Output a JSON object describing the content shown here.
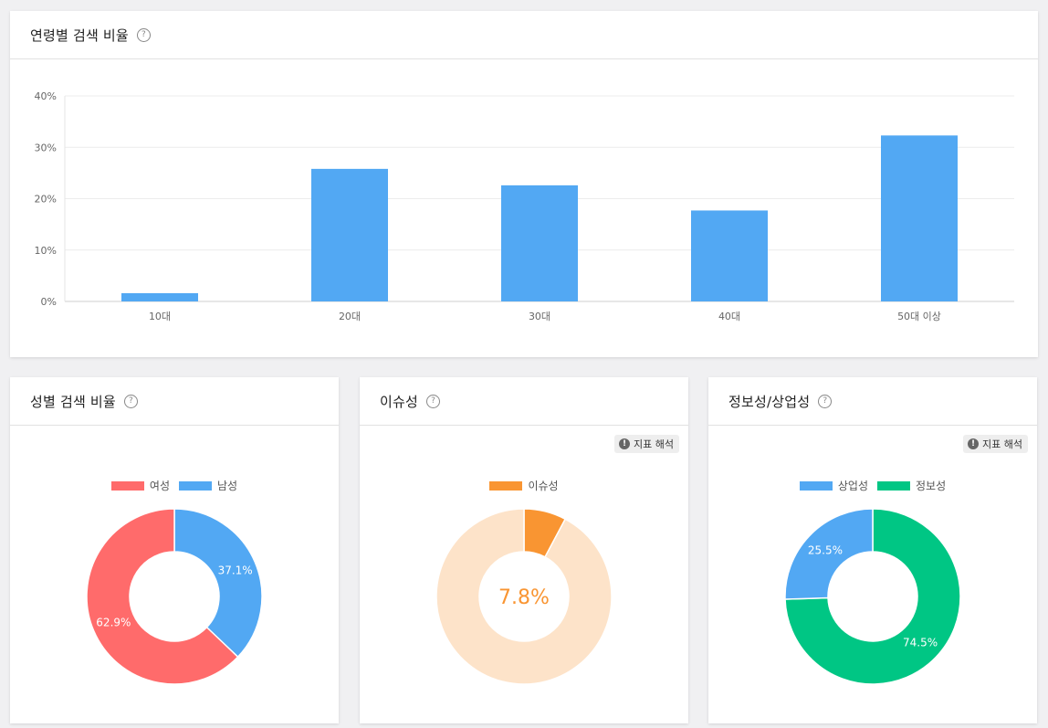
{
  "age_card": {
    "title": "연령별 검색 비율",
    "help": "?",
    "chart_data": {
      "type": "bar",
      "categories": [
        "10대",
        "20대",
        "30대",
        "40대",
        "50대 이상"
      ],
      "values": [
        1.6,
        25.8,
        22.6,
        17.7,
        32.3
      ],
      "ylim": [
        0,
        40
      ],
      "yticks": [
        "0%",
        "10%",
        "20%",
        "30%",
        "40%"
      ],
      "color": "#52a8f3",
      "grid": true
    }
  },
  "gender_card": {
    "title": "성별 검색 비율",
    "help": "?",
    "legend": [
      {
        "label": "여성",
        "color": "#ff6b6b"
      },
      {
        "label": "남성",
        "color": "#52a8f3"
      }
    ],
    "chart_data": {
      "type": "pie",
      "labels": [
        "남성",
        "여성"
      ],
      "values": [
        37.1,
        62.9
      ],
      "value_labels": [
        "37.1%",
        "62.9%"
      ],
      "colors": [
        "#52a8f3",
        "#ff6b6b"
      ]
    }
  },
  "issue_card": {
    "title": "이슈성",
    "help": "?",
    "interpret_label": "지표 해석",
    "legend": [
      {
        "label": "이슈성",
        "color": "#f99532"
      }
    ],
    "center_label": "7.8%",
    "chart_data": {
      "type": "pie",
      "labels": [
        "이슈성",
        ""
      ],
      "values": [
        7.8,
        92.2
      ],
      "colors": [
        "#f99532",
        "#fde3c9"
      ]
    }
  },
  "info_card": {
    "title": "정보성/상업성",
    "help": "?",
    "interpret_label": "지표 해석",
    "legend": [
      {
        "label": "상업성",
        "color": "#52a8f3"
      },
      {
        "label": "정보성",
        "color": "#00c684"
      }
    ],
    "chart_data": {
      "type": "pie",
      "labels": [
        "정보성",
        "상업성"
      ],
      "values": [
        74.5,
        25.5
      ],
      "value_labels": [
        "74.5%",
        "25.5%"
      ],
      "colors": [
        "#00c684",
        "#52a8f3"
      ]
    }
  }
}
